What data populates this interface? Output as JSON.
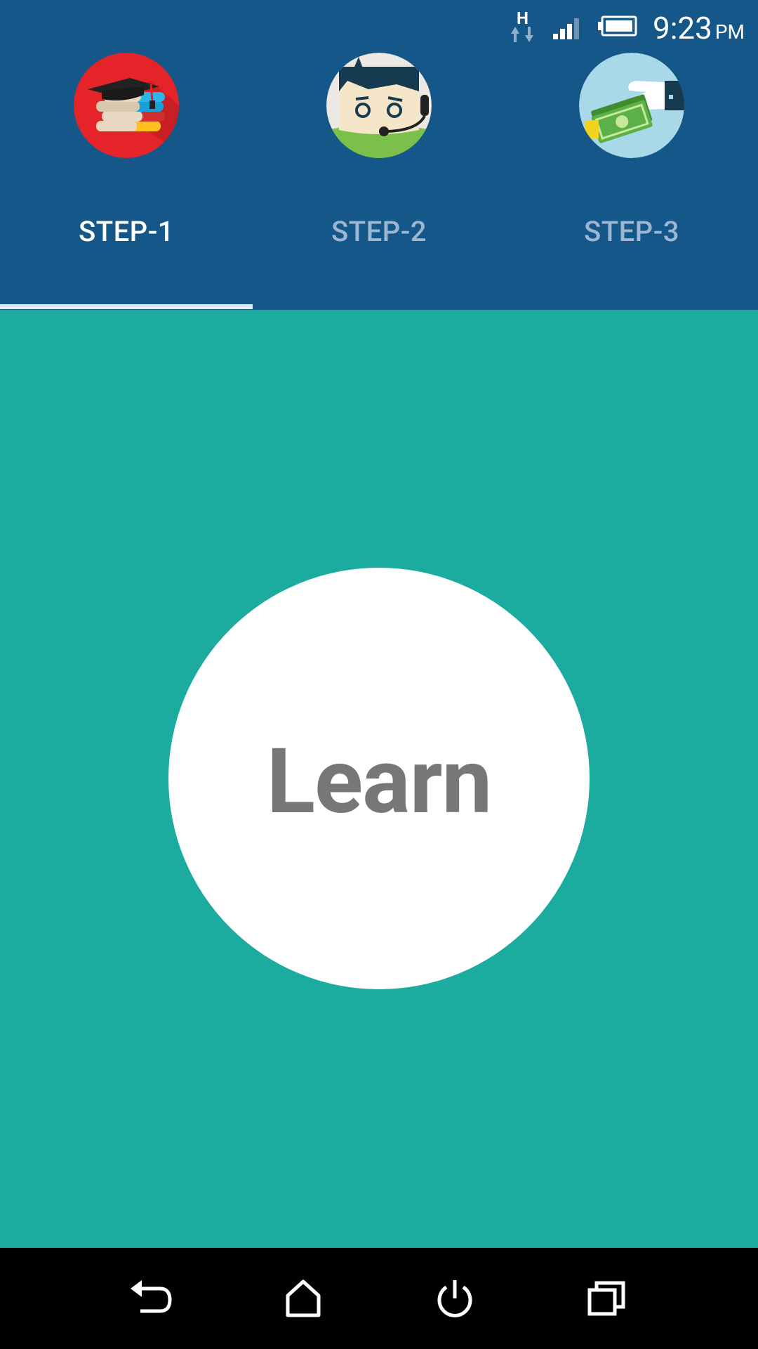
{
  "status_bar": {
    "network_type": "H",
    "time": "9:23",
    "ampm": "PM"
  },
  "tabs": [
    {
      "label": "STEP-1",
      "icon": "books-graduation-cap-icon",
      "active": true
    },
    {
      "label": "STEP-2",
      "icon": "support-agent-headset-icon",
      "active": false
    },
    {
      "label": "STEP-3",
      "icon": "money-hand-icon",
      "active": false
    }
  ],
  "main": {
    "button_label": "Learn"
  },
  "nav_bar": {
    "buttons": [
      "back-icon",
      "home-icon",
      "power-icon",
      "recent-apps-icon"
    ]
  },
  "colors": {
    "header": "#155788",
    "content": "#1bab9f",
    "active_tab": "#ffffff",
    "inactive_tab": "#9bb7d2",
    "learn_text": "#777777"
  }
}
